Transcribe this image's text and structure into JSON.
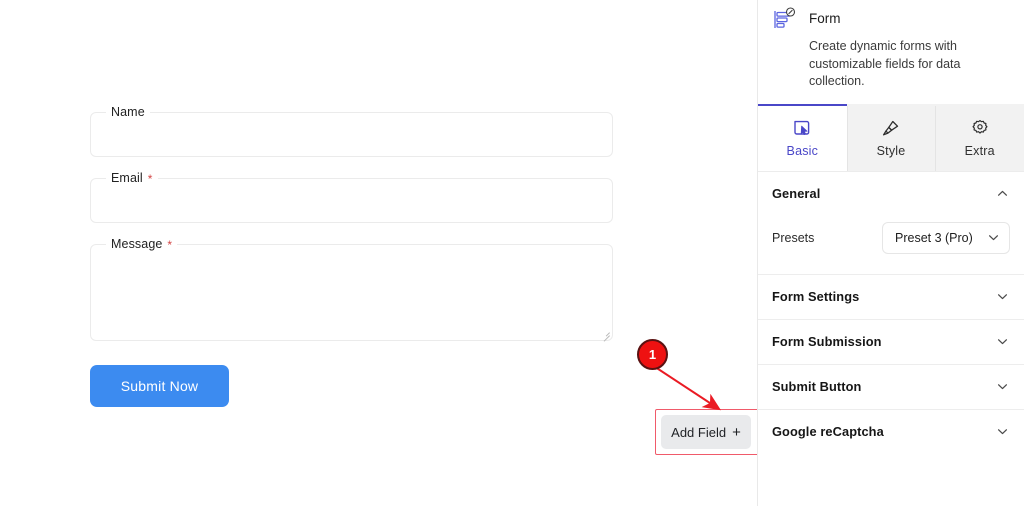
{
  "canvas": {
    "form": {
      "fields": [
        {
          "label": "Name",
          "required": false,
          "value": "",
          "placeholder": "",
          "type": "text"
        },
        {
          "label": "Email",
          "required": true,
          "value": "",
          "placeholder": "",
          "type": "text"
        },
        {
          "label": "Message",
          "required": true,
          "value": "",
          "placeholder": "",
          "type": "textarea"
        }
      ],
      "required_marker": "*",
      "submit_label": "Submit Now",
      "submit_color": "#3c8bf0"
    },
    "add_field": {
      "label": "Add Field",
      "plus_glyph": "+"
    },
    "annotation": {
      "step_number": "1",
      "marker_color": "#ee1111",
      "highlight_color": "#f05a6a"
    }
  },
  "panel": {
    "widget": {
      "title": "Form",
      "description": "Create dynamic forms with customizable fields for data collection.",
      "icon": "form-widget-icon",
      "icon_color": "#5b64e0"
    },
    "tabs": [
      {
        "label": "Basic",
        "icon": "cursor-square-icon",
        "active": true
      },
      {
        "label": "Style",
        "icon": "paint-brush-icon",
        "active": false
      },
      {
        "label": "Extra",
        "icon": "gear-icon",
        "active": false
      }
    ],
    "active_tab_color": "#4a47c8",
    "sections": [
      {
        "title": "General",
        "expanded": true,
        "chevron": "chevron-up-icon"
      },
      {
        "title": "Form Settings",
        "expanded": false,
        "chevron": "chevron-down-icon"
      },
      {
        "title": "Form Submission",
        "expanded": false,
        "chevron": "chevron-down-icon"
      },
      {
        "title": "Submit Button",
        "expanded": false,
        "chevron": "chevron-down-icon"
      },
      {
        "title": "Google reCaptcha",
        "expanded": false,
        "chevron": "chevron-down-icon"
      }
    ],
    "general": {
      "presets_label": "Presets",
      "presets_value": "Preset 3 (Pro)"
    }
  }
}
